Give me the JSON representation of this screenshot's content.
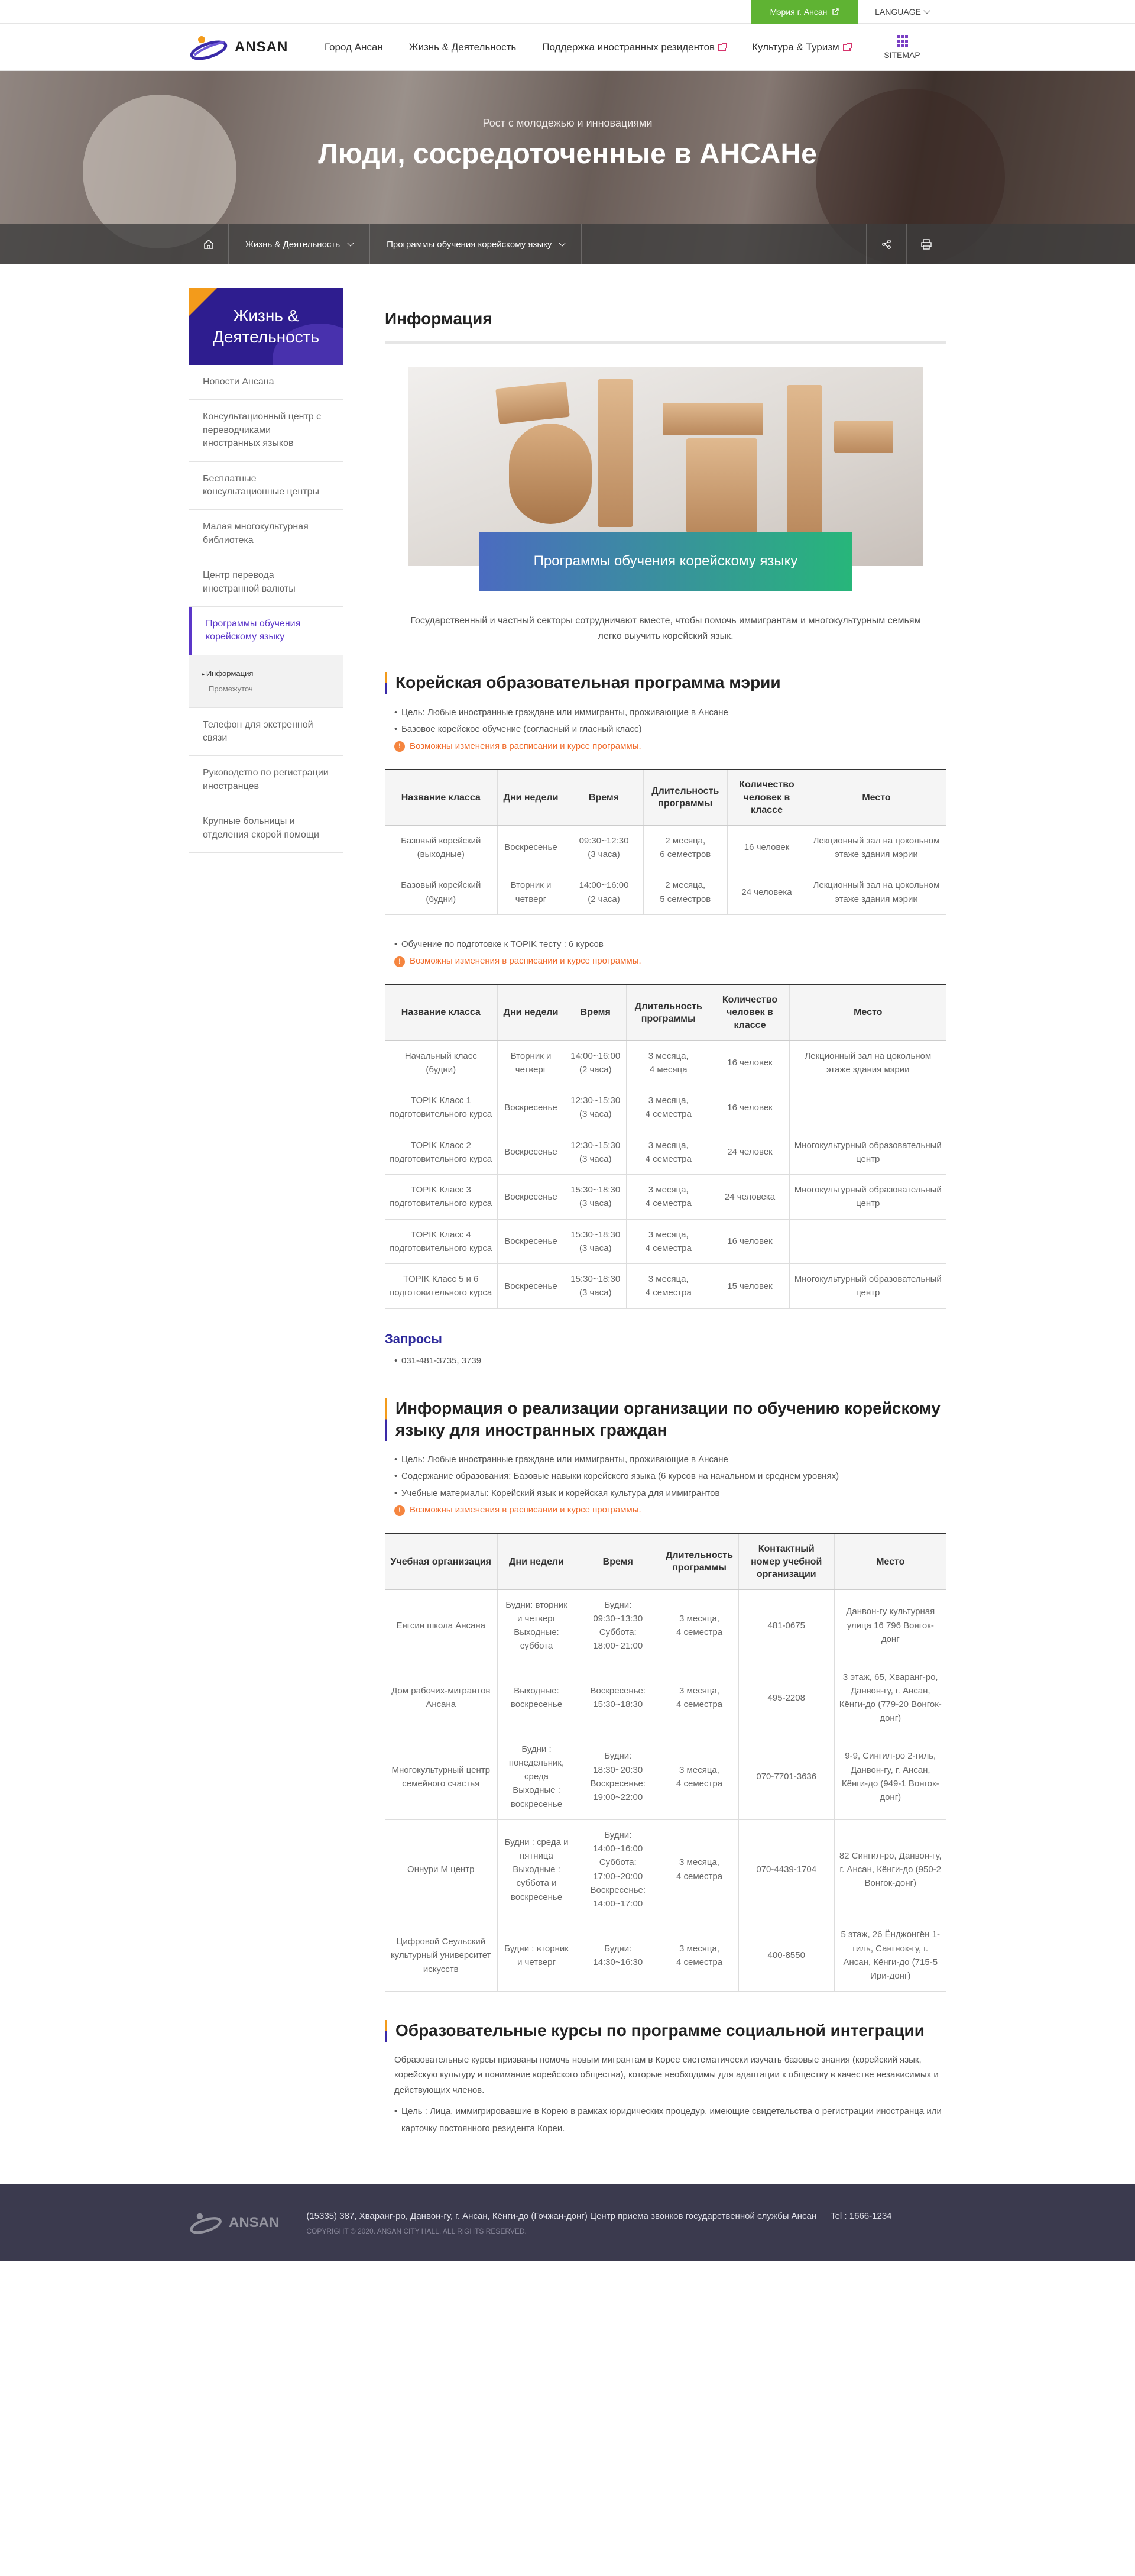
{
  "top": {
    "mayor_link": "Мэрия г. Ансан",
    "language": "LANGUAGE"
  },
  "header": {
    "logo": "ANSAN",
    "nav": [
      {
        "label": "Город Ансан",
        "external": false
      },
      {
        "label": "Жизнь & Деятельность",
        "external": false
      },
      {
        "label": "Поддержка иностранных резидентов",
        "external": true
      },
      {
        "label": "Культура & Туризм",
        "external": true
      }
    ],
    "sitemap": "SITEMAP"
  },
  "hero": {
    "subtitle": "Рост с молодежью и инновациями",
    "title": "Люди, сосредоточенные в АНСАНе"
  },
  "location": {
    "depth1": "Жизнь & Деятельность",
    "depth2": "Программы обучения корейскому языку"
  },
  "sidebar": {
    "title_line1": "Жизнь &",
    "title_line2": "Деятельность",
    "items": [
      "Новости Ансана",
      "Консультационный центр с переводчиками иностранных языков",
      "Бесплатные консультационные центры",
      "Малая многокультурная библиотека",
      "Центр перевода иностранной валюты",
      "Программы обучения корейскому языку",
      "Телефон для экстренной связи",
      "Руководство по регистрации иностранцев",
      "Крупные больницы и отделения скорой помощи"
    ],
    "sub_active": "Информация",
    "sub_other": "Промежуточ"
  },
  "content": {
    "page_title": "Информация",
    "banner_label": "Программы обучения корейскому языку",
    "banner_caption": "Государственный и частный секторы сотрудничают вместе, чтобы помочь иммигрантам и многокультурным семьям легко выучить корейский язык.",
    "notice": "Возможны изменения в расписании и курсе программы.",
    "section1": {
      "title": "Корейская образовательная программа мэрии",
      "bullets": [
        "Цель: Любые иностранные граждане или иммигранты, проживающие в Ансане",
        "Базовое корейское обучение (согласный и гласный класс)"
      ],
      "headers": [
        "Название класса",
        "Дни недели",
        "Время",
        "Длительность программы",
        "Количество человек в классе",
        "Место"
      ],
      "rows": [
        [
          "Базовый корейский (выходные)",
          "Воскресенье",
          "09:30~12:30\n(3 часа)",
          "2 месяца,\n6 семестров",
          "16 человек",
          "Лекционный зал на цокольном этаже здания мэрии"
        ],
        [
          "Базовый корейский (будни)",
          "Вторник и четверг",
          "14:00~16:00\n(2 часа)",
          "2 месяца,\n5 семестров",
          "24 человека",
          "Лекционный зал на цокольном этаже здания мэрии"
        ]
      ],
      "topik_bullet": "Обучение по подготовке к TOPIK тесту : 6 курсов",
      "headers2": [
        "Название класса",
        "Дни недели",
        "Время",
        "Длительность программы",
        "Количество человек в классе",
        "Место"
      ],
      "rows2": [
        [
          "Начальный класс (будни)",
          "Вторник и четверг",
          "14:00~16:00\n(2 часа)",
          "3 месяца,\n4 месяца",
          "16 человек",
          "Лекционный зал на цокольном этаже здания мэрии"
        ],
        [
          "TOPIK Класс 1 подготовительного курса",
          "Воскресенье",
          "12:30~15:30\n(3 часа)",
          "3 месяца,\n4 семестра",
          "16 человек",
          ""
        ],
        [
          "TOPIK Класс 2 подготовительного курса",
          "Воскресенье",
          "12:30~15:30\n(3 часа)",
          "3 месяца,\n4 семестра",
          "24 человек",
          "Многокультурный образовательный центр"
        ],
        [
          "TOPIK Класс 3 подготовительного курса",
          "Воскресенье",
          "15:30~18:30\n(3 часа)",
          "3 месяца,\n4 семестра",
          "24 человека",
          "Многокультурный образовательный центр"
        ],
        [
          "TOPIK Класс 4 подготовительного курса",
          "Воскресенье",
          "15:30~18:30\n(3 часа)",
          "3 месяца,\n4 семестра",
          "16 человек",
          ""
        ],
        [
          "TOPIK Класс 5 и 6 подготовительного курса",
          "Воскресенье",
          "15:30~18:30\n(3 часа)",
          "3 месяца,\n4 семестра",
          "15 человек",
          "Многокультурный образовательный центр"
        ]
      ]
    },
    "inquiry": {
      "title": "Запросы",
      "phone": "031-481-3735, 3739"
    },
    "section2": {
      "title": "Информация о реализации организации по обучению корейскому языку для иностранных граждан",
      "bullets": [
        "Цель: Любые иностранные граждане или иммигранты, проживающие в Ансане",
        "Содержание образования: Базовые навыки корейского языка (6 курсов на начальном и среднем уровнях)",
        "Учебные материалы: Корейский язык и корейская культура для иммигрантов"
      ],
      "headers": [
        "Учебная организация",
        "Дни недели",
        "Время",
        "Длительность программы",
        "Контактный номер учебной организации",
        "Место"
      ],
      "rows": [
        [
          "Енгсин школа Ансана",
          "Будни: вторник и четверг\nВыходные: суббота",
          "Будни: 09:30~13:30\nСуббота: 18:00~21:00",
          "3 месяца,\n4 семестра",
          "481-0675",
          "Данвон-гу культурная улица 16 796 Вонгок-донг"
        ],
        [
          "Дом рабочих-мигрантов Ансана",
          "Выходные: воскресенье",
          "Воскресенье: 15:30~18:30",
          "3 месяца,\n4 семестра",
          "495-2208",
          "3 этаж, 65, Хваранг-ро, Данвон-гу, г. Ансан, Кёнги-до (779-20 Вонгок-донг)"
        ],
        [
          "Многокультурный центр семейного счастья",
          "Будни : понедельник, среда\nВыходные : воскресенье",
          "Будни: 18:30~20:30\nВоскресенье: 19:00~22:00",
          "3 месяца,\n4 семестра",
          "070-7701-3636",
          "9-9, Сингил-ро 2-гиль, Данвон-гу, г. Ансан, Кёнги-до (949-1 Вонгок-донг)"
        ],
        [
          "Оннури М центр",
          "Будни : среда и пятница\nВыходные : суббота и воскресенье",
          "Будни: 14:00~16:00\nСуббота: 17:00~20:00\nВоскресенье: 14:00~17:00",
          "3 месяца,\n4 семестра",
          "070-4439-1704",
          "82 Сингил-ро, Данвон-гу, г. Ансан, Кёнги-до (950-2 Вонгок-донг)"
        ],
        [
          "Цифровой Сеульский культурный университет искусств",
          "Будни : вторник и четверг",
          "Будни: 14:30~16:30",
          "3 месяца,\n4 семестра",
          "400-8550",
          "5 этаж, 26 Ёнджонгён 1-гиль, Сангнок-гу, г. Ансан, Кёнги-до (715-5 Ири-донг)"
        ]
      ]
    },
    "section3": {
      "title": "Образовательные курсы по программе социальной интеграции",
      "paragraph": "Образовательные курсы призваны помочь новым мигрантам в Корее систематически изучать базовые знания (корейский язык, корейскую культуру и понимание корейского общества), которые необходимы для адаптации к обществу в качестве независимых и действующих членов.",
      "bullet": "Цель : Лица, иммигрировавшие в Корею в рамках юридических процедур, имеющие свидетельства о регистрации иностранца или карточку постоянного резидента Кореи."
    }
  },
  "footer": {
    "logo": "ANSAN",
    "address": "(15335) 387, Хваранг-ро, Данвон-гу, г. Ансан, Кёнги-до (Гочжан-донг) Центр приема звонков государственной службы Ансан",
    "tel": "Tel : 1666-1234",
    "copyright": "COPYRIGHT © 2020. ANSAN CITY HALL. ALL RIGHTS RESERVED."
  },
  "colors": {
    "brand": "#2e1d8f",
    "accent_orange": "#f39b1b",
    "notice": "#f06a2a",
    "green": "#5fb333",
    "footer": "#3b3a4e"
  }
}
